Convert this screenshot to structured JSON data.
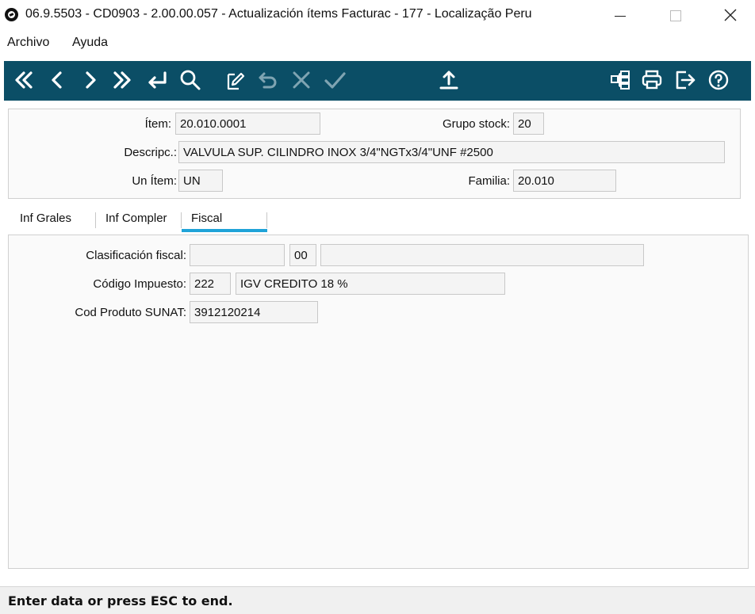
{
  "window": {
    "title": "06.9.5503 - CD0903 - 2.00.00.057 - Actualización ítems Facturac - 177 - Localização Peru",
    "controls": [
      "minimize-icon",
      "maximize-icon",
      "close-icon"
    ]
  },
  "menu": {
    "archivo": "Archivo",
    "ayuda": "Ayuda"
  },
  "toolbar": {
    "background": "#0b4e66",
    "icons": [
      "first-record-icon",
      "previous-record-icon",
      "next-record-icon",
      "last-record-icon",
      "goto-icon",
      "search-icon",
      "edit-icon",
      "undo-icon",
      "cancel-icon",
      "confirm-icon",
      "export-icon",
      "tree-icon",
      "print-icon",
      "exit-icon",
      "help-icon"
    ]
  },
  "header": {
    "item_label": "Ítem:",
    "item_value": "20.010.0001",
    "grupo_label": "Grupo stock:",
    "grupo_value": "20",
    "descripc_label": "Descripc.:",
    "descripc_value": "VALVULA SUP. CILINDRO INOX 3/4\"NGTx3/4\"UNF #2500",
    "unitem_label": "Un Ítem:",
    "unitem_value": "UN",
    "familia_label": "Familia:",
    "familia_value": "20.010"
  },
  "tabs": {
    "inf_grales": "Inf Grales",
    "inf_compler": "Inf Compler",
    "fiscal": "Fiscal",
    "active": "Fiscal",
    "accent": "#1fa3d8"
  },
  "fiscal": {
    "clasificacion_label": "Clasificación fiscal:",
    "clasificacion_value": "",
    "clasificacion_code": "00",
    "clasificacion_desc": "",
    "codigo_label": "Código Impuesto:",
    "codigo_value": "222",
    "codigo_desc": "IGV CREDITO 18 %",
    "sunat_label": "Cod Produto SUNAT:",
    "sunat_value": "3912120214"
  },
  "status": {
    "message": "Enter data or press ESC to end."
  }
}
